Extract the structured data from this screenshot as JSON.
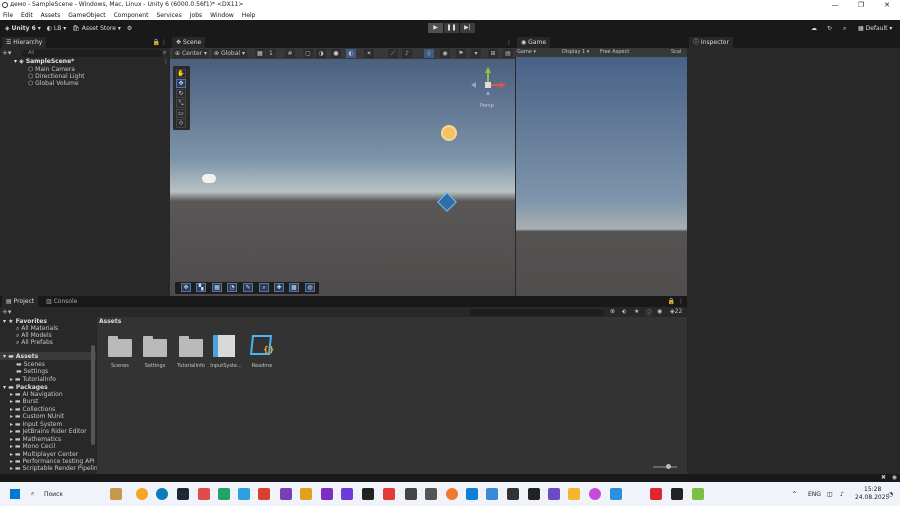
{
  "window": {
    "title": "демо - SampleScene - Windows, Mac, Linux - Unity 6 (6000.0.56f1)* <DX11>",
    "min": "—",
    "max": "❐",
    "close": "✕"
  },
  "menu": [
    "File",
    "Edit",
    "Assets",
    "GameObject",
    "Component",
    "Services",
    "Jobs",
    "Window",
    "Help"
  ],
  "toolbar": {
    "account": "Unity 6",
    "lb": "LB",
    "asset_store": "Asset Store",
    "layout": "Default"
  },
  "hierarchy": {
    "tab": "Hierarchy",
    "search": "All",
    "scene": "SampleScene*",
    "items": [
      "Main Camera",
      "Directional Light",
      "Global Volume"
    ]
  },
  "scene": {
    "tab": "Scene",
    "pivot": "Center",
    "space": "Global",
    "snap": "1",
    "persp": "Persp"
  },
  "game": {
    "tab": "Game",
    "mode": "Game",
    "display": "Display 1",
    "aspect": "Free Aspect",
    "scale": "Scal"
  },
  "inspector": {
    "tab": "Inspector"
  },
  "project": {
    "tab_project": "Project",
    "tab_console": "Console",
    "count": "22",
    "breadcrumb": "Assets",
    "favorites_label": "Favorites",
    "favorites": [
      "All Materials",
      "All Models",
      "All Prefabs"
    ],
    "assets_label": "Assets",
    "assets_tree": [
      "Scenes",
      "Settings",
      "TutorialInfo"
    ],
    "packages_label": "Packages",
    "packages": [
      "AI Navigation",
      "Burst",
      "Collections",
      "Custom NUnit",
      "Input System",
      "JetBrains Rider Editor",
      "Mathematics",
      "Mono Cecil",
      "Multiplayer Center",
      "Performance testing API",
      "Scriptable Render Pipeline"
    ],
    "grid": [
      "Scenes",
      "Settings",
      "TutorialInfo",
      "InputSyste...",
      "Readme"
    ]
  },
  "taskbar": {
    "search": "Поиск",
    "lang": "ENG",
    "time": "15:28",
    "date": "24.08.2025"
  }
}
